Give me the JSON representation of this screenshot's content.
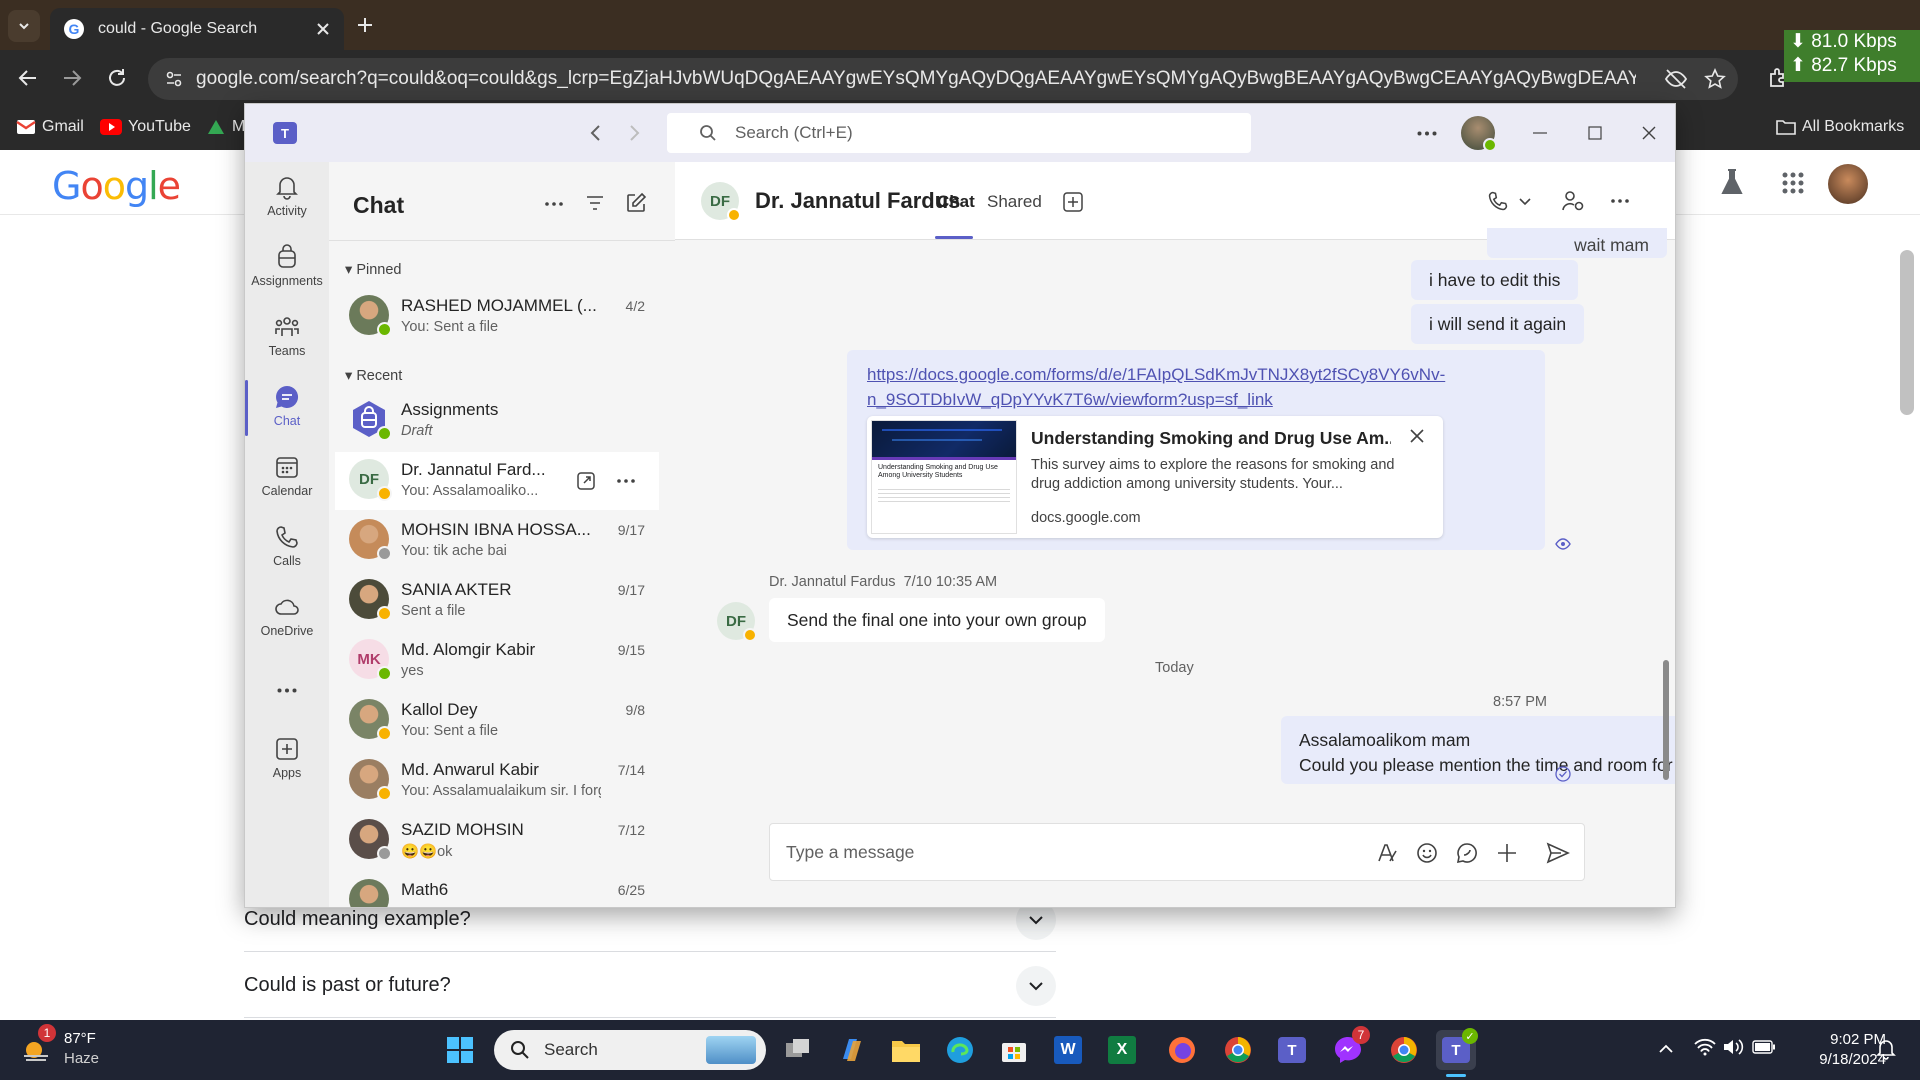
{
  "browser": {
    "tab_title": "could - Google Search",
    "url": "google.com/search?q=could&oq=could&gs_lcrp=EgZjaHJvbWUqDQgAEAAYgwEYsQMYgAQyDQgAEAAYgwEYsQMYgAQyBwgBEAAYgAQyBwgCEAAYgAQyBwgDEAAYgAQyBwgEEAAYgAQy...",
    "bookmarks": [
      "Gmail",
      "YouTube",
      "M"
    ],
    "all_bookmarks": "All Bookmarks",
    "net_down": "81.0 Kbps",
    "net_up": "82.7 Kbps"
  },
  "google": {
    "logo": "Google",
    "faqs": [
      "Could meaning example?",
      "Could is past or future?"
    ]
  },
  "teams": {
    "search_placeholder": "Search (Ctrl+E)",
    "rail": [
      {
        "label": "Activity",
        "icon": "bell-icon"
      },
      {
        "label": "Assignments",
        "icon": "backpack-icon"
      },
      {
        "label": "Teams",
        "icon": "teams-icon"
      },
      {
        "label": "Chat",
        "icon": "chat-icon"
      },
      {
        "label": "Calendar",
        "icon": "calendar-icon"
      },
      {
        "label": "Calls",
        "icon": "phone-icon"
      },
      {
        "label": "OneDrive",
        "icon": "cloud-icon"
      },
      {
        "label": "Apps",
        "icon": "apps-icon"
      }
    ],
    "chat_title": "Chat",
    "pinned_label": "Pinned",
    "recent_label": "Recent",
    "pinned": [
      {
        "name": "RASHED MOJAMMEL (...",
        "sub": "You: Sent a file",
        "date": "4/2",
        "status": "available",
        "avatar_color": "#6b7a5a"
      }
    ],
    "recent": [
      {
        "name": "Assignments",
        "sub": "Draft",
        "date": "",
        "status": "available",
        "avatar_color": "#5b5fc7",
        "initials": ""
      },
      {
        "name": "Dr. Jannatul Fard...",
        "sub": "You: Assalamoaliko...",
        "date": "",
        "status": "away",
        "avatar_color": "#dfe9e0",
        "initials": "DF"
      },
      {
        "name": "MOHSIN IBNA HOSSA...",
        "sub": "You: tik ache bai",
        "date": "9/17",
        "status": "offline",
        "avatar_color": "#c58b5a",
        "initials": ""
      },
      {
        "name": "SANIA AKTER",
        "sub": "Sent a file",
        "date": "9/17",
        "status": "away",
        "avatar_color": "#4c4b3a",
        "initials": ""
      },
      {
        "name": "Md. Alomgir Kabir",
        "sub": "yes",
        "date": "9/15",
        "status": "available",
        "avatar_color": "#f6dde6",
        "initials": "MK"
      },
      {
        "name": "Kallol Dey",
        "sub": "You: Sent a file",
        "date": "9/8",
        "status": "away",
        "avatar_color": "#7a8466",
        "initials": ""
      },
      {
        "name": "Md. Anwarul Kabir",
        "sub": "You: Assalamualaikum sir. I forg...",
        "date": "7/14",
        "status": "away",
        "avatar_color": "#9a7e62",
        "initials": ""
      },
      {
        "name": "SAZID MOHSIN",
        "sub": "😀😀ok",
        "date": "7/12",
        "status": "offline",
        "avatar_color": "#5a4e49",
        "initials": ""
      },
      {
        "name": "Math6",
        "sub": "",
        "date": "6/25",
        "status": "",
        "avatar_color": "#6c7a5c",
        "initials": ""
      }
    ],
    "header": {
      "initials": "DF",
      "name": "Dr. Jannatul Fardus",
      "tab_chat": "Chat",
      "tab_shared": "Shared"
    },
    "messages": {
      "top_partial": "wait mam",
      "m1": "i have to edit this",
      "m2": "i will send it again",
      "link_line1": "https://docs.google.com/forms/d/e/1FAIpQLSdKmJvTNJX8yt2fSCy8VY6vNv-",
      "link_line2": "n_9SOTDbIvW_qDpYYvK7T6w/viewform?usp=sf_link",
      "card_title": "Understanding Smoking and Drug Use Am...",
      "card_desc": "This survey aims to explore the reasons for smoking and drug addiction among university students. Your...",
      "card_domain": "docs.google.com",
      "card_thumb_title": "Understanding Smoking and Drug Use Among University Students",
      "sender_meta": "Dr. Jannatul Fardus  7/10 10:35 AM",
      "incoming": "Send the final one into your own group",
      "day_divider": "Today",
      "last_time": "8:57 PM",
      "last_line1": "Assalamoalikom mam",
      "last_line2": "Could you please mention the time and room for tomorrow class?"
    },
    "compose_placeholder": "Type a message"
  },
  "taskbar": {
    "weather_temp": "87°F",
    "weather_desc": "Haze",
    "weather_badge": "1",
    "search_label": "Search",
    "time": "9:02 PM",
    "date": "9/18/2024",
    "messenger_badge": "7"
  },
  "colors": {
    "teams_brand": "#5b5fc7",
    "available": "#6bb700",
    "away": "#f8b200",
    "bubble": "#e8ebfa"
  }
}
